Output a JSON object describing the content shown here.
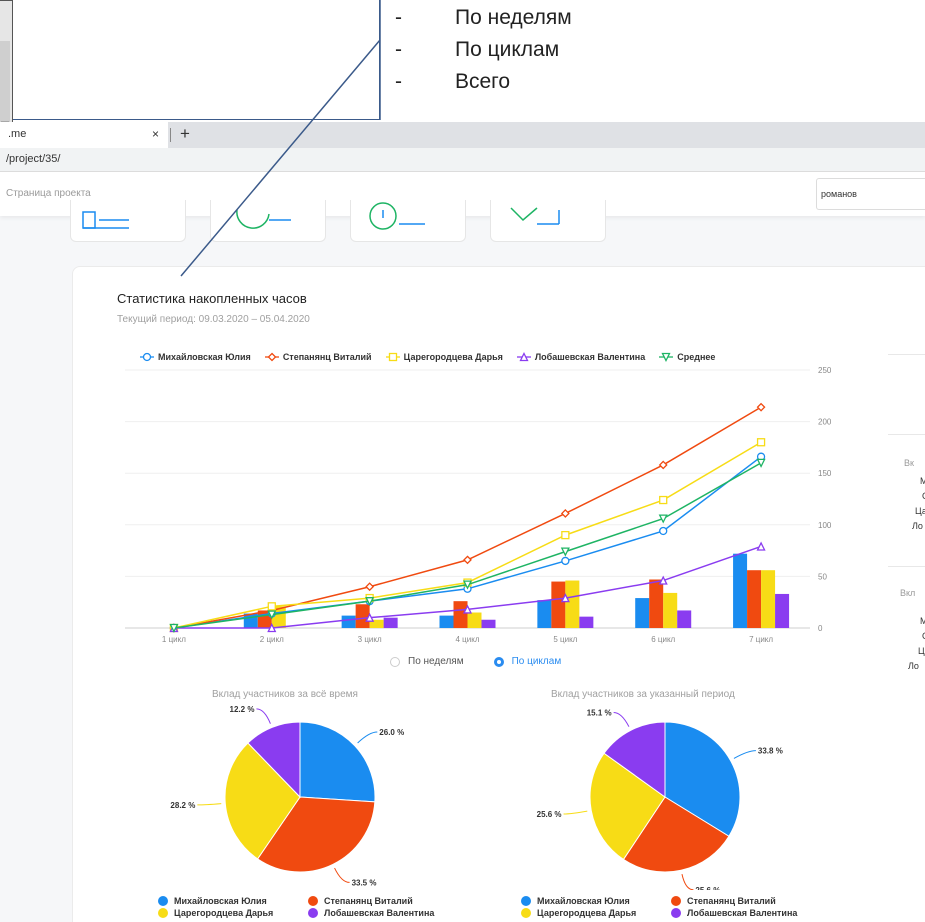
{
  "annotation": {
    "items": [
      "По неделям",
      "По циклам",
      "Всего"
    ],
    "dash": "-"
  },
  "browser": {
    "tab_title": ".me",
    "tab_close": "×",
    "new_tab": "+",
    "url": "/project/35/"
  },
  "header": {
    "breadcrumb": "Страница проекта",
    "user": "романов"
  },
  "stats": {
    "title": "Статистика накопленных часов",
    "subtitle": "Текущий период: 09.03.2020 – 05.04.2020"
  },
  "legend": [
    {
      "name": "Михайловская Юлия",
      "color": "#1a8cf0",
      "marker": "circle"
    },
    {
      "name": "Степанянц Виталий",
      "color": "#f04a10",
      "marker": "diamond"
    },
    {
      "name": "Царегородцева Дарья",
      "color": "#f7dc16",
      "marker": "square"
    },
    {
      "name": "Лобашевская Валентина",
      "color": "#8a3cf0",
      "marker": "triangle"
    },
    {
      "name": "Среднее",
      "color": "#1eb464",
      "marker": "triangle-down"
    }
  ],
  "view_toggle": {
    "options": [
      "По неделям",
      "По циклам"
    ],
    "selected": "По циклам"
  },
  "chart_data": [
    {
      "type": "bar",
      "categories": [
        "1 цикл",
        "2 цикл",
        "3 цикл",
        "4 цикл",
        "5 цикл",
        "6 цикл",
        "7 цикл"
      ],
      "ylim": [
        0,
        250
      ],
      "yticks": [
        "0",
        "50",
        "100",
        "150",
        "200",
        "250"
      ],
      "bars": [
        {
          "name": "Михайловская Юлия",
          "values": [
            0,
            14,
            12,
            12,
            27,
            29,
            72
          ]
        },
        {
          "name": "Степанянц Виталий",
          "values": [
            0,
            17,
            23,
            26,
            45,
            47,
            56
          ]
        },
        {
          "name": "Царегородцева Дарья",
          "values": [
            0,
            21,
            8,
            15,
            46,
            34,
            56
          ]
        },
        {
          "name": "Лобашевская Валентина",
          "values": [
            0,
            0,
            10,
            8,
            11,
            17,
            33
          ]
        }
      ],
      "lines": [
        {
          "name": "Михайловская Юлия",
          "values": [
            0,
            14,
            26,
            38,
            65,
            94,
            166
          ]
        },
        {
          "name": "Степанянц Виталий",
          "values": [
            0,
            17,
            40,
            66,
            111,
            158,
            214
          ]
        },
        {
          "name": "Царегородцева Дарья",
          "values": [
            0,
            21,
            29,
            44,
            90,
            124,
            180
          ]
        },
        {
          "name": "Лобашевская Валентина",
          "values": [
            0,
            0,
            10,
            18,
            29,
            46,
            79
          ]
        },
        {
          "name": "Среднее",
          "values": [
            0,
            13,
            26,
            42,
            74,
            106,
            160
          ]
        }
      ]
    },
    {
      "type": "pie",
      "title": "Вклад участников за всё время",
      "slices": [
        {
          "name": "Михайловская Юлия",
          "value": 26.0,
          "label": "26.0 %"
        },
        {
          "name": "Степанянц Виталий",
          "value": 33.5,
          "label": "33.5 %"
        },
        {
          "name": "Царегородцева Дарья",
          "value": 28.2,
          "label": "28.2 %"
        },
        {
          "name": "Лобашевская Валентина",
          "value": 12.2,
          "label": "12.2 %"
        }
      ]
    },
    {
      "type": "pie",
      "title": "Вклад участников за указанный период",
      "slices": [
        {
          "name": "Михайловская Юлия",
          "value": 33.8,
          "label": "33.8 %"
        },
        {
          "name": "Степанянц Виталий",
          "value": 25.6,
          "label": "25.6 %"
        },
        {
          "name": "Царегородцева Дарья",
          "value": 25.6,
          "label": "25.6 %"
        },
        {
          "name": "Лобашевская Валентина",
          "value": 15.1,
          "label": "15.1 %"
        }
      ]
    }
  ],
  "right_panel": {
    "labels": [
      "Вк",
      "М",
      "С",
      "Ца",
      "Ло",
      "Вкл",
      "М",
      "С",
      "Ц",
      "Ло"
    ]
  }
}
